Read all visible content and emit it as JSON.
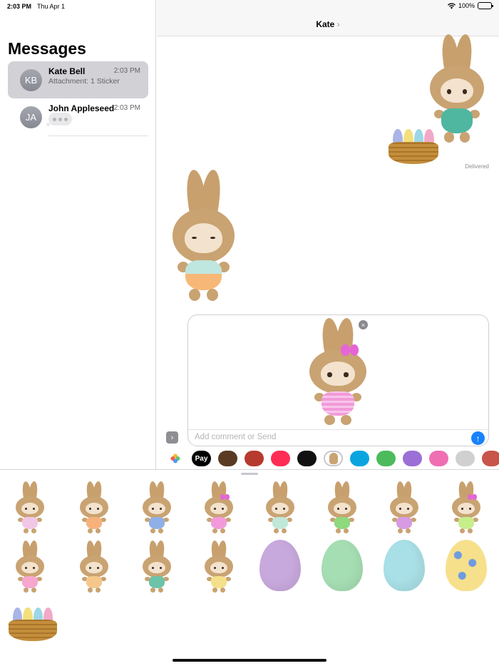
{
  "status_bar": {
    "time": "2:03 PM",
    "date": "Thu Apr 1",
    "battery": "100%"
  },
  "sidebar": {
    "title": "Messages",
    "conversations": [
      {
        "initials": "KB",
        "name": "Kate Bell",
        "time": "2:03 PM",
        "preview": "Attachment: 1 Sticker",
        "selected": true
      },
      {
        "initials": "JA",
        "name": "John Appleseed",
        "time": "2:03 PM",
        "preview": "",
        "typing": true
      }
    ]
  },
  "chat": {
    "contact_name": "Kate",
    "chevron": "›",
    "delivered_label": "Delivered",
    "sent_stickers": [
      "bunny-overalls-with-egg-basket"
    ],
    "received_stickers": [
      "bunny-sleepy-yawn"
    ]
  },
  "compose": {
    "placeholder": "Add comment or Send",
    "attached_sticker": "bunny-pink-bow",
    "remove_glyph": "×",
    "send_glyph": "↑",
    "expand_glyph": "›"
  },
  "app_strip": {
    "apps": [
      {
        "name": "photos-app",
        "label": "",
        "color": "#ffffff"
      },
      {
        "name": "apple-pay-app",
        "label": "Pay",
        "color": "#000000"
      },
      {
        "name": "memoji-app",
        "label": "",
        "color": "#5a3a22"
      },
      {
        "name": "animoji-app",
        "label": "",
        "color": "#b63a2e"
      },
      {
        "name": "images-search-app",
        "label": "",
        "color": "#ff2d55"
      },
      {
        "name": "digital-touch-app",
        "label": "",
        "color": "#111111"
      },
      {
        "name": "bunny-stickers-app",
        "label": "",
        "color": "#ffffff",
        "selected": true
      },
      {
        "name": "sticker-pack-yellow",
        "label": "",
        "color": "#0aa5e0"
      },
      {
        "name": "sticker-pack-green",
        "label": "",
        "color": "#4cbb5c"
      },
      {
        "name": "sticker-pack-purple",
        "label": "",
        "color": "#9b6fd6"
      },
      {
        "name": "sticker-pack-pink",
        "label": "",
        "color": "#f06fb3"
      },
      {
        "name": "sticker-pack-grid",
        "label": "",
        "color": "#d0d0d0"
      },
      {
        "name": "sticker-pack-flower",
        "label": "",
        "color": "#c9544a"
      }
    ]
  },
  "drawer": {
    "stickers": [
      {
        "name": "bunny-tutu-pink",
        "kind": "bunny",
        "color": "#f2c6e6"
      },
      {
        "name": "bunny-orange-shorts",
        "kind": "bunny",
        "color": "#f6b27a"
      },
      {
        "name": "bunny-blue-shorts",
        "kind": "bunny",
        "color": "#8fb0e6"
      },
      {
        "name": "bunny-pink-bow",
        "kind": "bunny",
        "color": "#f29ad9",
        "bow": true
      },
      {
        "name": "bunny-green-dress",
        "kind": "bunny",
        "color": "#bfe8d9"
      },
      {
        "name": "bunny-green-smile",
        "kind": "bunny",
        "color": "#8ed87e"
      },
      {
        "name": "bunny-purple-shorts",
        "kind": "bunny",
        "color": "#d69be0"
      },
      {
        "name": "bunny-green-stripes",
        "kind": "bunny",
        "color": "#c6ee8a",
        "bow": true
      },
      {
        "name": "bunny-pink-tutu",
        "kind": "bunny",
        "color": "#f6a6cf"
      },
      {
        "name": "bunny-orange-mint",
        "kind": "bunny",
        "color": "#f5c78a"
      },
      {
        "name": "bunny-teal-overalls",
        "kind": "bunny",
        "color": "#6cc3a8"
      },
      {
        "name": "bunny-yellow-mint",
        "kind": "bunny",
        "color": "#f4e08a"
      },
      {
        "name": "egg-purple",
        "kind": "egg",
        "color": "#c8a9dd"
      },
      {
        "name": "egg-green",
        "kind": "egg",
        "color": "#a6deb3"
      },
      {
        "name": "egg-blue",
        "kind": "egg",
        "color": "#a9dfe6"
      },
      {
        "name": "egg-flowers",
        "kind": "egg",
        "color": "#f7e08c"
      },
      {
        "name": "egg-basket",
        "kind": "basket",
        "color": "#c48e3c"
      }
    ]
  }
}
